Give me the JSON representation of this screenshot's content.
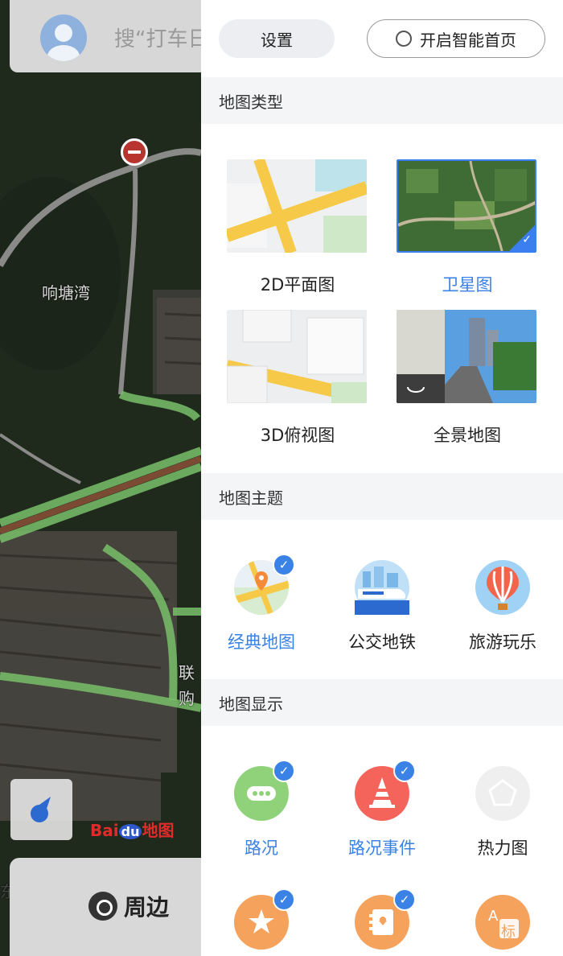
{
  "map": {
    "search_placeholder": "搜“打车日",
    "place_xiangtangwan": "响塘湾",
    "place_lian": "联",
    "place_gou": "购",
    "place_dong": "东",
    "logo_text": "Bai",
    "logo_du": "du",
    "logo_suffix": "地图",
    "nearby_label": "周边"
  },
  "panel": {
    "settings_label": "设置",
    "smart_home_label": "开启智能首页",
    "sections": {
      "map_type": "地图类型",
      "map_theme": "地图主题",
      "map_display": "地图显示"
    },
    "map_types": [
      {
        "label": "2D平面图",
        "selected": false
      },
      {
        "label": "卫星图",
        "selected": true
      },
      {
        "label": "3D俯视图",
        "selected": false
      },
      {
        "label": "全景地图",
        "selected": false
      }
    ],
    "themes": [
      {
        "label": "经典地图",
        "selected": true
      },
      {
        "label": "公交地铁",
        "selected": false
      },
      {
        "label": "旅游玩乐",
        "selected": false
      }
    ],
    "display": [
      {
        "label": "路况",
        "checked": true
      },
      {
        "label": "路况事件",
        "checked": true
      },
      {
        "label": "热力图",
        "checked": false
      }
    ],
    "display_row2": [
      {
        "icon": "star-icon",
        "checked": true
      },
      {
        "icon": "contacts-icon",
        "checked": true
      },
      {
        "icon": "label-icon",
        "checked": false,
        "text": "标"
      }
    ]
  },
  "colors": {
    "accent": "#3b82e6",
    "traffic_green": "#8fd27a",
    "event_red": "#f4645a",
    "orange": "#f5a25d"
  }
}
